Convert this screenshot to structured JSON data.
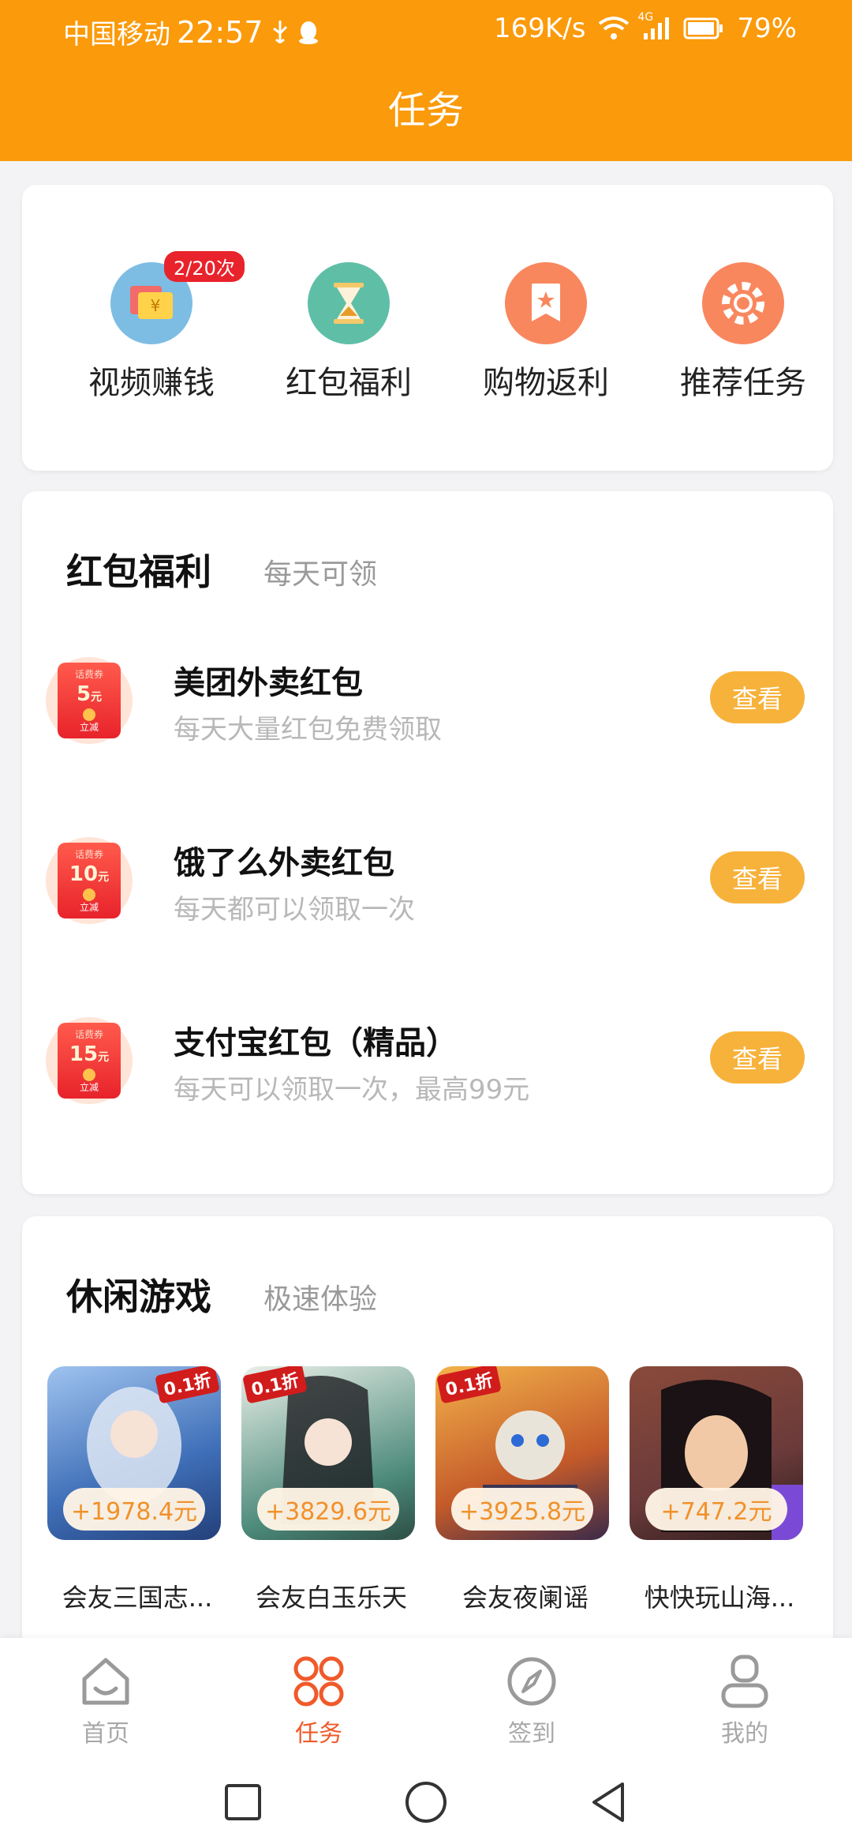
{
  "status_bar": {
    "carrier": "中国移动",
    "time": "22:57",
    "net_speed": "169K/s",
    "signal_label": "4G",
    "battery": "79%"
  },
  "header": {
    "title": "任务"
  },
  "quick_actions": [
    {
      "label": "视频赚钱",
      "icon": "video-ticket-icon",
      "color": "#7dbde3",
      "badge": "2/20次"
    },
    {
      "label": "红包福利",
      "icon": "hourglass-icon",
      "color": "#5fbfa6"
    },
    {
      "label": "购物返利",
      "icon": "bookmark-star-icon",
      "color": "#f9875e"
    },
    {
      "label": "推荐任务",
      "icon": "wheel-icon",
      "color": "#f9875e"
    }
  ],
  "red_packets": {
    "title": "红包福利",
    "subtitle": "每天可领",
    "items": [
      {
        "name": "美团外卖红包",
        "desc": "每天大量红包免费领取",
        "coupon_top": "话费券",
        "amount": "5",
        "unit": "元",
        "coupon_action": "立减",
        "button": "查看"
      },
      {
        "name": "饿了么外卖红包",
        "desc": "每天都可以领取一次",
        "coupon_top": "话费券",
        "amount": "10",
        "unit": "元",
        "coupon_action": "立减",
        "button": "查看"
      },
      {
        "name": "支付宝红包（精品）",
        "desc": "每天可以领取一次，最高99元",
        "coupon_top": "话费券",
        "amount": "15",
        "unit": "元",
        "coupon_action": "立减",
        "button": "查看"
      }
    ]
  },
  "games": {
    "title": "休闲游戏",
    "subtitle": "极速体验",
    "items": [
      {
        "name": "会友三国志...",
        "reward": "+1978.4元",
        "discount": "0.1折",
        "bg": "#3f6fb8"
      },
      {
        "name": "会友白玉乐天",
        "reward": "+3829.6元",
        "discount": "0.1折",
        "bg": "#4c8a7a"
      },
      {
        "name": "会友夜阑谣",
        "reward": "+3925.8元",
        "discount": "0.1折",
        "bg": "#c45a2a"
      },
      {
        "name": "快快玩山海...",
        "reward": "+747.2元",
        "discount": "",
        "bg": "#6a3a3a"
      }
    ]
  },
  "bottom_nav": [
    {
      "label": "首页",
      "icon": "home-icon",
      "active": false
    },
    {
      "label": "任务",
      "icon": "grid-four-icon",
      "active": true
    },
    {
      "label": "签到",
      "icon": "compass-icon",
      "active": false
    },
    {
      "label": "我的",
      "icon": "profile-icon",
      "active": false
    }
  ],
  "colors": {
    "accent": "#fb9a0a",
    "button": "#f7b23b",
    "active_tab": "#f05a2a",
    "badge": "#e8232b"
  }
}
